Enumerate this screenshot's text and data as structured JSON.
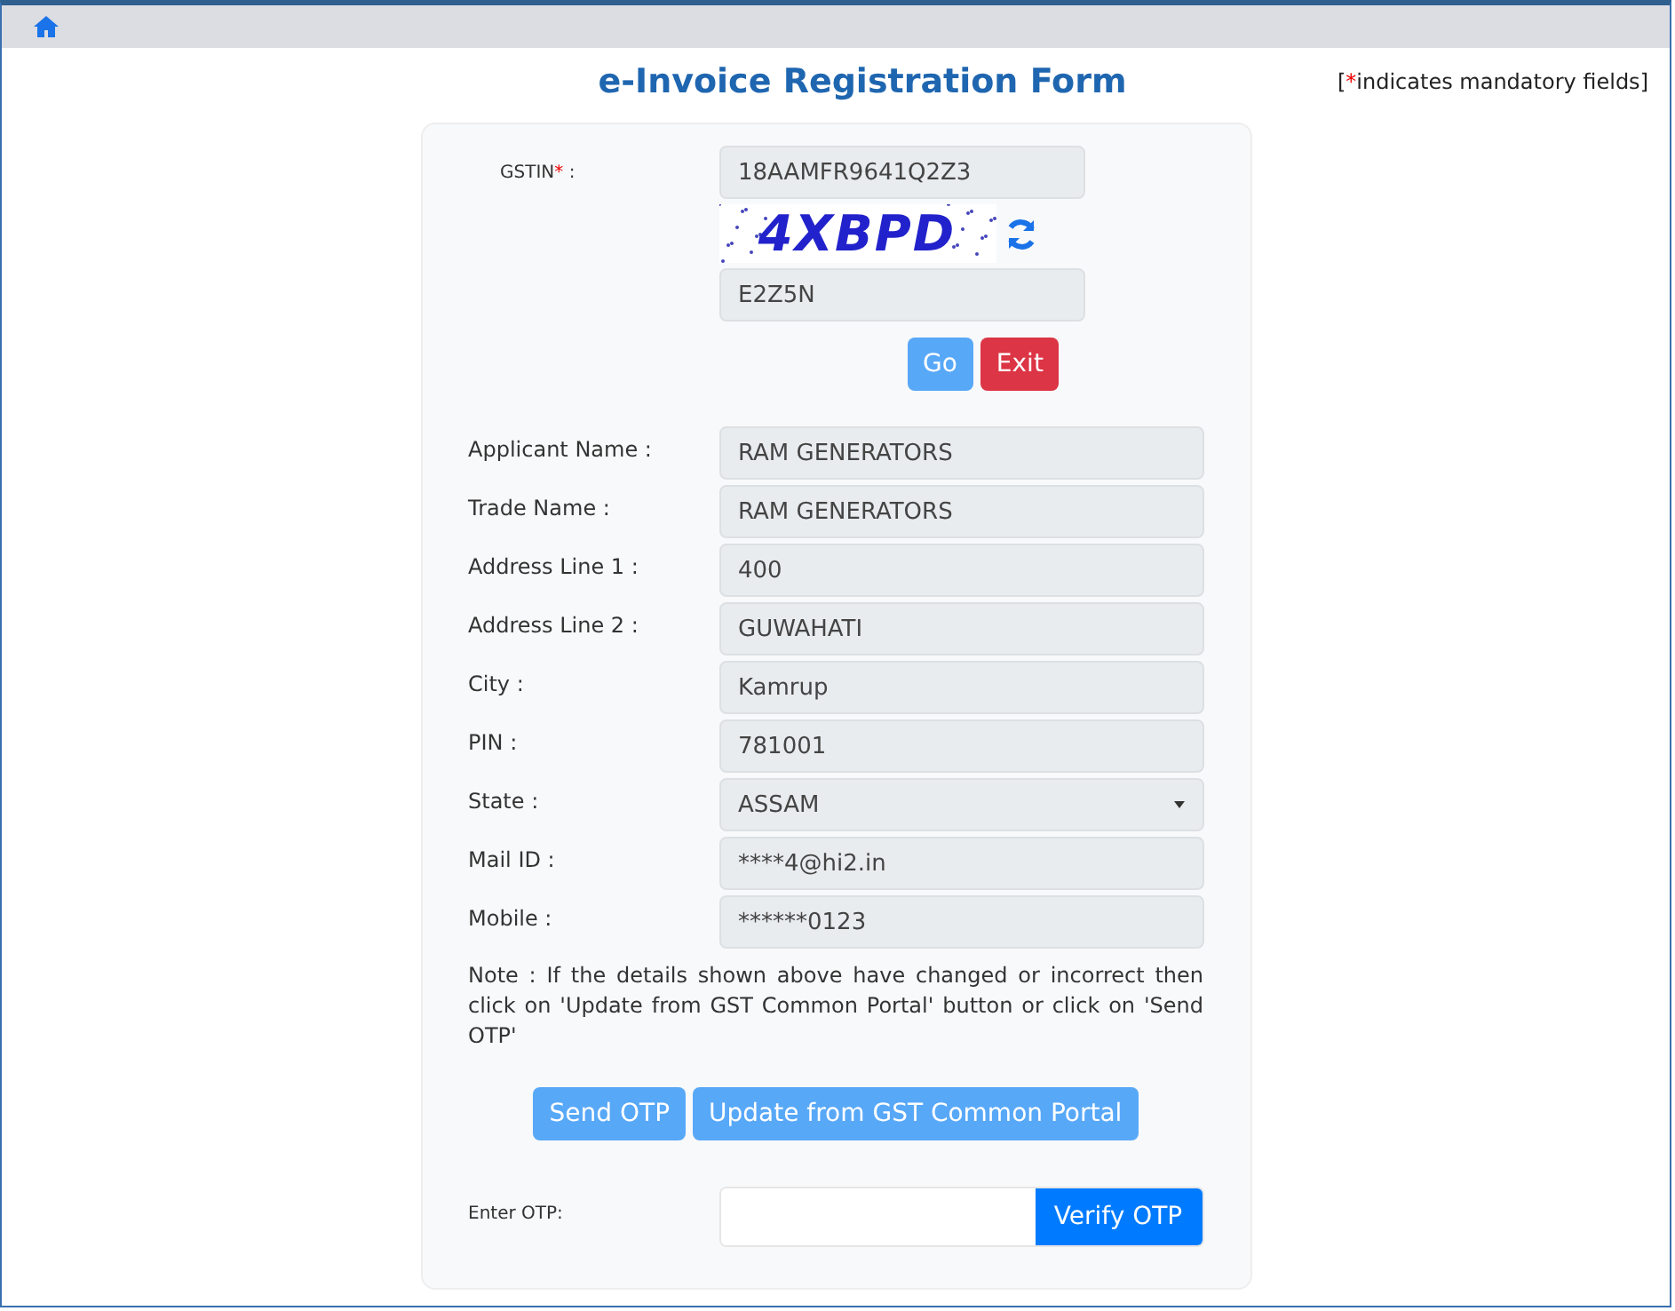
{
  "title": "e-Invoice Registration Form",
  "mandatory_note": {
    "open": "[",
    "marker": "*",
    "text": "indicates mandatory fields]"
  },
  "gstin": {
    "label": "GSTIN",
    "marker": "*",
    "colon": ":",
    "value": "18AAMFR9641Q2Z3"
  },
  "captcha": {
    "text": "4XBPD",
    "value": "E2Z5N"
  },
  "top_buttons": [
    {
      "label": "Go",
      "kind": "light"
    },
    {
      "label": "Exit",
      "kind": "danger"
    }
  ],
  "fields": [
    {
      "label": "Applicant Name :",
      "value": "RAM GENERATORS",
      "kind": "input"
    },
    {
      "label": "Trade Name :",
      "value": "RAM GENERATORS",
      "kind": "input"
    },
    {
      "label": "Address Line 1 :",
      "value": "400",
      "kind": "input"
    },
    {
      "label": "Address Line 2 :",
      "value": "GUWAHATI",
      "kind": "input"
    },
    {
      "label": "City :",
      "value": "Kamrup",
      "kind": "input"
    },
    {
      "label": "PIN :",
      "value": "781001",
      "kind": "input"
    },
    {
      "label": "State :",
      "value": "ASSAM",
      "kind": "select"
    },
    {
      "label": "Mail ID :",
      "value": "****4@hi2.in",
      "kind": "input"
    },
    {
      "label": "Mobile :",
      "value": "******0123",
      "kind": "input"
    }
  ],
  "note": "Note : If the details shown above have changed or incorrect then click on 'Update from GST Common Portal' button or click on 'Send OTP'",
  "action_buttons": [
    {
      "label": "Send OTP",
      "kind": "light"
    },
    {
      "label": "Update from GST Common Portal",
      "kind": "light"
    }
  ],
  "otp": {
    "label": "Enter OTP:",
    "button": "Verify OTP"
  }
}
